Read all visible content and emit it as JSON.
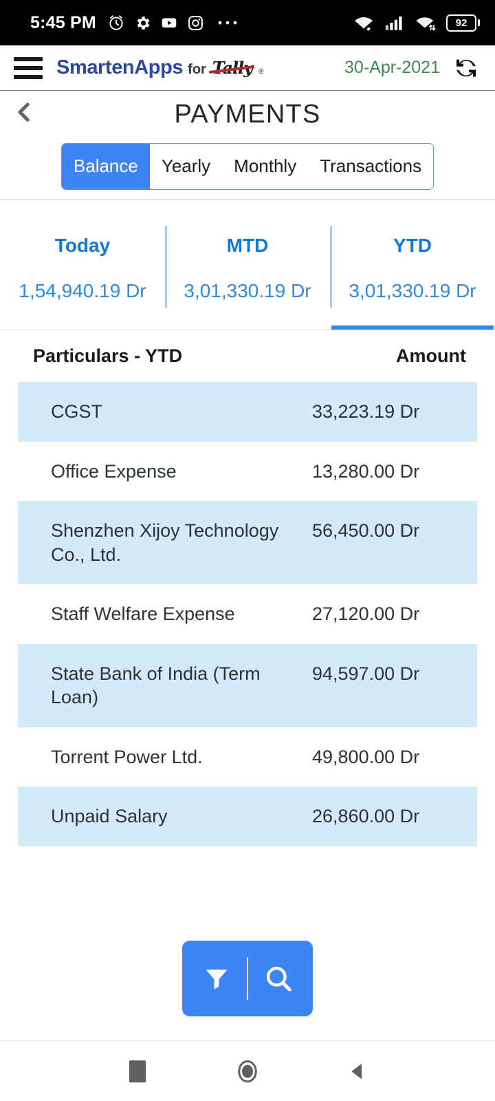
{
  "status_bar": {
    "time": "5:45 PM",
    "left_icons": [
      "alarm-icon",
      "gear-icon",
      "youtube-icon",
      "instagram-icon",
      "overflow-dots-icon"
    ],
    "right_icons": [
      "wifi-link-icon",
      "cellular-signal-icon",
      "wifi-transfer-icon"
    ],
    "battery_level": "92"
  },
  "app_bar": {
    "menu_icon": "hamburger-menu-icon",
    "brand_main": "SmartenApps",
    "brand_for": "for",
    "brand_product": "Tally",
    "brand_reg": "®",
    "date": "30-Apr-2021",
    "refresh_icon": "refresh-icon"
  },
  "title_bar": {
    "back_icon": "chevron-left-icon",
    "title": "PAYMENTS"
  },
  "tabs": {
    "items": [
      {
        "label": "Balance",
        "active": true
      },
      {
        "label": "Yearly",
        "active": false
      },
      {
        "label": "Monthly",
        "active": false
      },
      {
        "label": "Transactions",
        "active": false
      }
    ]
  },
  "summary": {
    "cells": [
      {
        "label": "Today",
        "value": "1,54,940.19 Dr",
        "active": false
      },
      {
        "label": "MTD",
        "value": "3,01,330.19 Dr",
        "active": false
      },
      {
        "label": "YTD",
        "value": "3,01,330.19 Dr",
        "active": true
      }
    ]
  },
  "table": {
    "col_particulars": "Particulars - YTD",
    "col_amount": "Amount",
    "rows": [
      {
        "name": "CGST",
        "amount": "33,223.19 Dr"
      },
      {
        "name": "Office Expense",
        "amount": "13,280.00 Dr"
      },
      {
        "name": "Shenzhen Xijoy Technology Co., Ltd.",
        "amount": "56,450.00 Dr"
      },
      {
        "name": "Staff Welfare Expense",
        "amount": "27,120.00 Dr"
      },
      {
        "name": "State Bank of India (Term Loan)",
        "amount": "94,597.00 Dr"
      },
      {
        "name": "Torrent Power Ltd.",
        "amount": "49,800.00 Dr"
      },
      {
        "name": "Unpaid Salary",
        "amount": "26,860.00 Dr"
      }
    ]
  },
  "actions": {
    "filter_icon": "filter-funnel-icon",
    "search_icon": "search-magnifier-icon"
  },
  "nav_bar": {
    "recents_icon": "recents-square-icon",
    "home_icon": "home-circle-icon",
    "back_icon": "back-triangle-icon"
  },
  "colors": {
    "accent_blue": "#3d84f5",
    "link_blue": "#1678d6",
    "row_alt": "#d5eaf8",
    "date_green": "#3f8a4f",
    "brand_blue": "#2b4a9e"
  }
}
